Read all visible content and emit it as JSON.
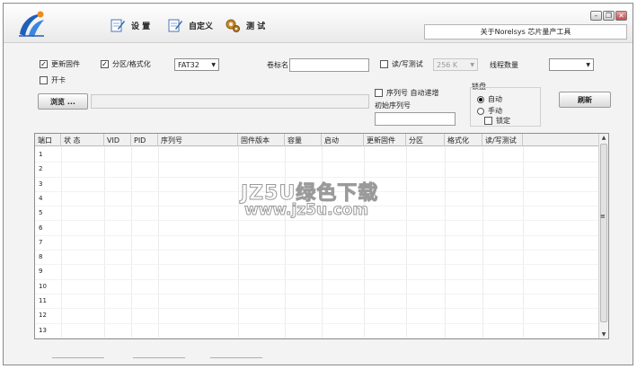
{
  "toolbar": {
    "settings_label": "设 置",
    "custom_label": "自定义",
    "test_label": "测 试"
  },
  "about_text": "关于Norelsys 芯片量产工具",
  "options": {
    "update_firmware": "更新固件",
    "partition_format": "分区/格式化",
    "fs_value": "FAT32",
    "volume_label": "卷标名",
    "rw_test": "读/写测试",
    "rw_size": "256 K",
    "thread_count": "线程数量",
    "open_card": "开卡",
    "browse": "浏览 ...",
    "serial_auto": "序列号 自动递增",
    "initial_serial": "初始序列号",
    "disk_group": "锁盘",
    "auto": "自动",
    "manual": "手动",
    "lock": "锁定",
    "refresh": "刷新"
  },
  "table": {
    "columns": [
      "端口",
      "状 态",
      "VID",
      "PID",
      "序列号",
      "固件版本",
      "容量",
      "启动",
      "更新固件",
      "分区",
      "格式化",
      "读/写测试"
    ],
    "rows": [
      "1",
      "2",
      "3",
      "4",
      "5",
      "6",
      "7",
      "8",
      "9",
      "10",
      "11",
      "12",
      "13"
    ]
  },
  "watermark": {
    "title": "JZ5U绿色下载",
    "url": "www.jz5u.com"
  },
  "colors": {
    "logo_blue": "#1f5fb8",
    "logo_orange": "#f08a1c"
  }
}
